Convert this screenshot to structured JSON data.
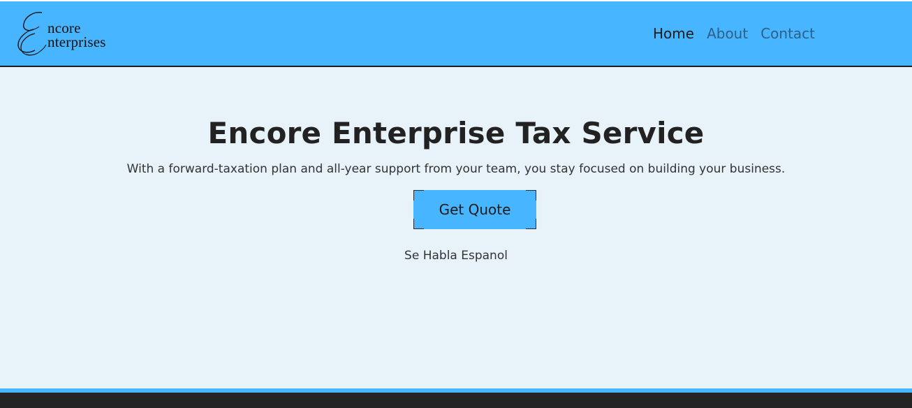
{
  "brand": {
    "logo_line1": "ncore",
    "logo_line2": "nterprises",
    "colors": {
      "header_bg": "#47b5ff",
      "page_bg": "#e7f2f9",
      "footer_bg": "#242424",
      "accent": "#47b5ff"
    }
  },
  "nav": {
    "items": [
      {
        "label": "Home",
        "active": true
      },
      {
        "label": "About",
        "active": false
      },
      {
        "label": "Contact",
        "active": false
      }
    ]
  },
  "hero": {
    "title": "Encore Enterprise Tax Service",
    "subtitle": "With a forward-taxation plan and all-year support from your team, you stay focused on building your business.",
    "cta_label": "Get Quote",
    "note": "Se Habla Espanol"
  }
}
